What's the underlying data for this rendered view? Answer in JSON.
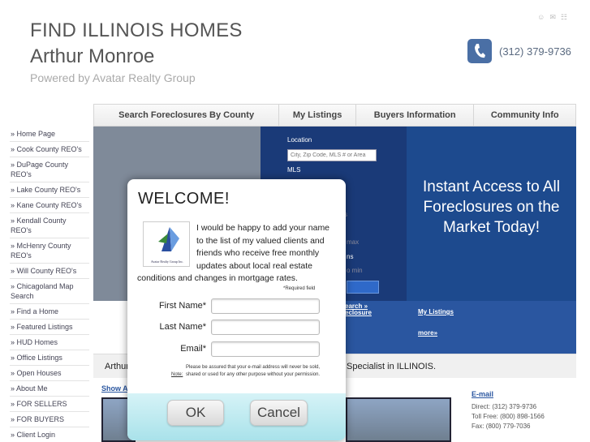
{
  "header": {
    "site_title": "FIND ILLINOIS HOMES",
    "agent_name": "Arthur Monroe",
    "powered_by": "Powered by Avatar Realty Group",
    "phone": "(312) 379-9736",
    "top_icons": [
      "user-icon",
      "mail-icon",
      "sitemap-icon"
    ]
  },
  "nav": {
    "items": [
      {
        "label": "Search Foreclosures By County"
      },
      {
        "label": "My Listings"
      },
      {
        "label": "Buyers Information"
      },
      {
        "label": "Community Info"
      }
    ]
  },
  "sidebar": {
    "items": [
      "» Home Page",
      "» Cook County REO's",
      "» DuPage County REO's",
      "» Lake County REO's",
      "» Kane County REO's",
      "» Kendall County REO's",
      "» McHenry County REO's",
      "» Will County REO's",
      "» Chicagoland Map Search",
      "» Find a Home",
      "» Featured Listings",
      "» HUD Homes",
      "» Office Listings",
      "» Open Houses",
      "» About Me",
      "» FOR SELLERS",
      "» FOR BUYERS",
      "» Client Login"
    ]
  },
  "search": {
    "location_label": "Location",
    "location_placeholder": "City, Zip Code, MLS # or Area",
    "mls_label": "MLS",
    "partial_select": "s",
    "max_placeholder": "max",
    "partial_label": "ns",
    "partial_select2": "o min",
    "search_link": "earch »",
    "foreclosure_link": "eclosure"
  },
  "hero": {
    "headline": "Instant Access to All Foreclosures on the Market Today!",
    "my_listings": "My Listings",
    "more": "more»"
  },
  "banner": {
    "left_text": "Arthur",
    "right_text": "Specialist in ILLINOIS."
  },
  "content": {
    "show_all": "Show A"
  },
  "contact": {
    "email_label": "E-mail",
    "direct": "Direct: (312) 379-9736",
    "toll_free": "Toll Free: (800) 898-1566",
    "fax": "Fax: (800) 779-7036"
  },
  "modal": {
    "title": "WELCOME!",
    "logo_caption": "Avatar Realty Group Inc.",
    "message": "I would be happy to add your name to the list of my valued clients and friends who receive free monthly updates about local real estate conditions and changes in mortgage rates.",
    "required_note": "*Required field",
    "first_name_label": "First Name*",
    "last_name_label": "Last Name*",
    "email_label": "Email*",
    "privacy": "Please be assured that your e-mail address will never be sold, shared or used for any other purpose without your permission.",
    "note_label": "Note:",
    "ok_label": "OK",
    "cancel_label": "Cancel"
  }
}
